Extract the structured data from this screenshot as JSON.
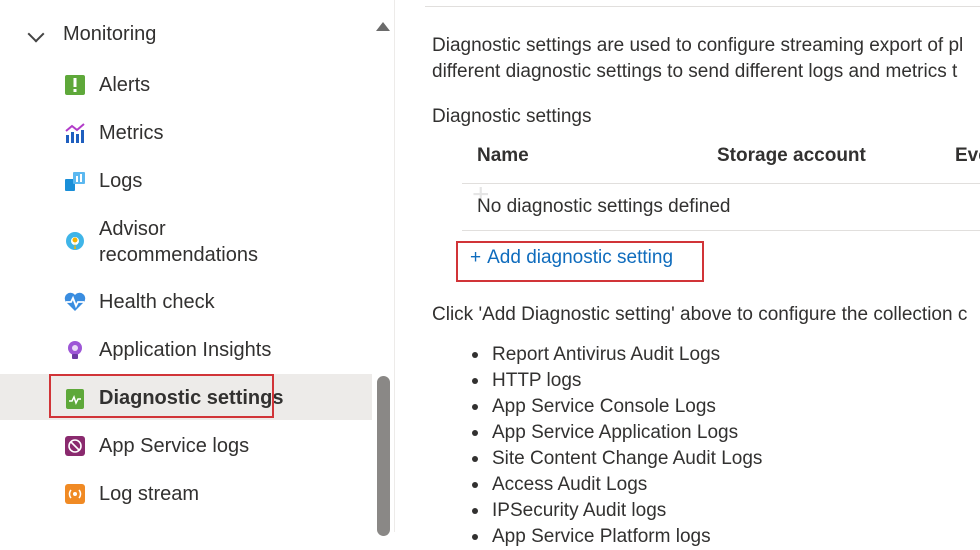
{
  "sidebar": {
    "group": "Monitoring",
    "items": [
      {
        "label": "Alerts",
        "icon": "alerts-icon"
      },
      {
        "label": "Metrics",
        "icon": "metrics-icon"
      },
      {
        "label": "Logs",
        "icon": "logs-icon"
      },
      {
        "label": "Advisor\nrecommendations",
        "label1": "Advisor",
        "label2": "recommendations",
        "icon": "advisor-icon"
      },
      {
        "label": "Health check",
        "icon": "health-check-icon"
      },
      {
        "label": "Application Insights",
        "icon": "app-insights-icon"
      },
      {
        "label": "Diagnostic settings",
        "icon": "diagnostic-settings-icon",
        "selected": true
      },
      {
        "label": "App Service logs",
        "icon": "app-service-logs-icon"
      },
      {
        "label": "Log stream",
        "icon": "log-stream-icon"
      }
    ]
  },
  "main": {
    "description_line1": "Diagnostic settings are used to configure streaming export of pl",
    "description_line2": "different diagnostic settings to send different logs and metrics t",
    "section_title": "Diagnostic settings",
    "columns": [
      "Name",
      "Storage account",
      "Eve"
    ],
    "empty_text": "No diagnostic settings defined",
    "add_label": "Add diagnostic setting",
    "click_text": "Click 'Add Diagnostic setting' above to configure the collection c",
    "bullets": [
      "Report Antivirus Audit Logs",
      "HTTP logs",
      "App Service Console Logs",
      "App Service Application Logs",
      "Site Content Change Audit Logs",
      "Access Audit Logs",
      "IPSecurity Audit logs",
      "App Service Platform logs"
    ]
  },
  "colors": {
    "accent": "#0f6cbd",
    "highlight_border": "#d13438",
    "selected_bg": "#edebe9"
  }
}
